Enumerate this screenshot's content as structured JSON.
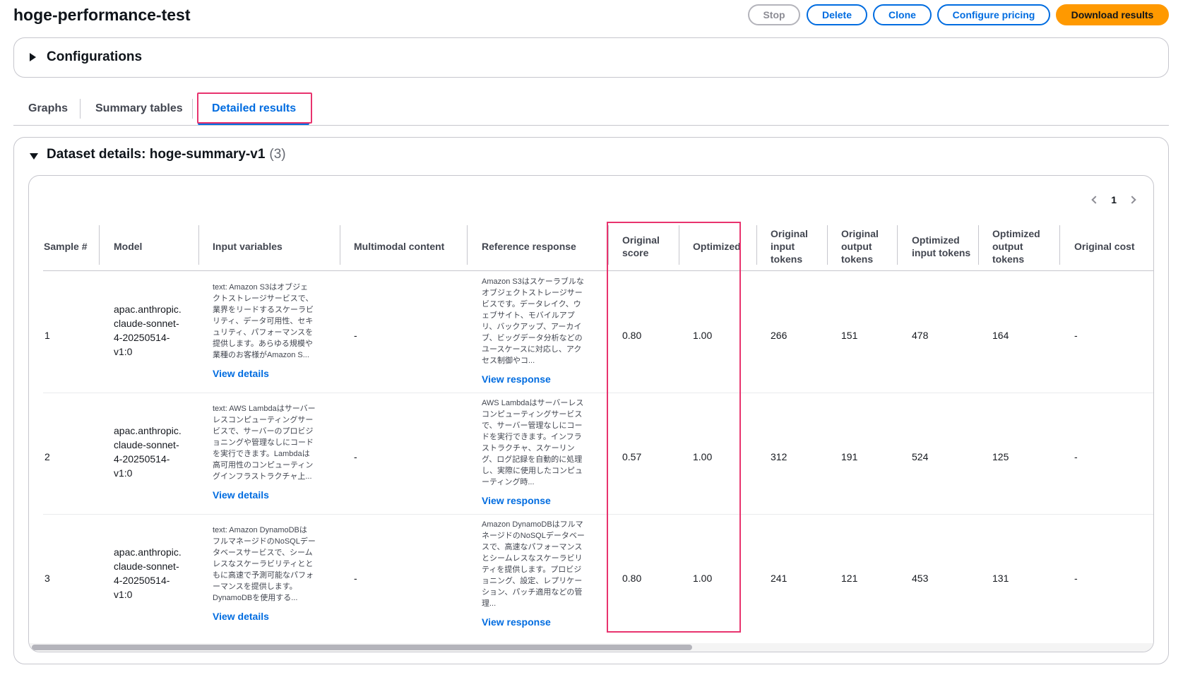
{
  "page": {
    "title": "hoge-performance-test"
  },
  "actions": {
    "stop": "Stop",
    "delete": "Delete",
    "clone": "Clone",
    "configure_pricing": "Configure pricing",
    "download_results": "Download results"
  },
  "configurations": {
    "title": "Configurations"
  },
  "tabs": [
    {
      "label": "Graphs"
    },
    {
      "label": "Summary tables"
    },
    {
      "label": "Detailed results"
    }
  ],
  "dataset": {
    "title": "Dataset details: hoge-summary-v1",
    "count": "(3)"
  },
  "pagination": {
    "current_page": "1"
  },
  "table": {
    "columns": [
      "Sample #",
      "Model",
      "Input variables",
      "Multimodal content",
      "Reference response",
      "Original score",
      "Optimized score",
      "Original input tokens",
      "Original output tokens",
      "Optimized input tokens",
      "Optimized output tokens",
      "Original cost"
    ],
    "view_details_label": "View details",
    "view_response_label": "View response",
    "rows": [
      {
        "sample": "1",
        "model": [
          "apac.anthropic.",
          "claude-sonnet-",
          "4-20250514-",
          "v1:0"
        ],
        "input_variables": [
          "text: Amazon S3はオブジェ",
          "クトストレージサービスで、",
          "業界をリードするスケーラビ",
          "リティ、データ可用性、セキ",
          "ュリティ、パフォーマンスを",
          "提供します。あらゆる規模や",
          "業種のお客様がAmazon S..."
        ],
        "multimodal": "-",
        "reference_response": [
          "Amazon S3はスケーラブルな",
          "オブジェクトストレージサー",
          "ビスです。データレイク、ウ",
          "ェブサイト、モバイルアプ",
          "リ、バックアップ、アーカイ",
          "ブ、ビッグデータ分析などの",
          "ユースケースに対応し、アク",
          "セス制御やコ..."
        ],
        "original_score": "0.80",
        "optimized_score": "1.00",
        "original_input_tokens": "266",
        "original_output_tokens": "151",
        "optimized_input_tokens": "478",
        "optimized_output_tokens": "164",
        "original_cost": "-"
      },
      {
        "sample": "2",
        "model": [
          "apac.anthropic.",
          "claude-sonnet-",
          "4-20250514-",
          "v1:0"
        ],
        "input_variables": [
          "text: AWS Lambdaはサーバー",
          "レスコンピューティングサー",
          "ビスで、サーバーのプロビジ",
          "ョニングや管理なしにコード",
          "を実行できます。Lambdaは",
          "高可用性のコンピューティン",
          "グインフラストラクチャ上..."
        ],
        "multimodal": "-",
        "reference_response": [
          "AWS Lambdaはサーバーレス",
          "コンピューティングサービス",
          "で、サーバー管理なしにコー",
          "ドを実行できます。インフラ",
          "ストラクチャ、スケーリン",
          "グ、ログ記録を自動的に処理",
          "し、実際に使用したコンピュ",
          "ーティング時..."
        ],
        "original_score": "0.57",
        "optimized_score": "1.00",
        "original_input_tokens": "312",
        "original_output_tokens": "191",
        "optimized_input_tokens": "524",
        "optimized_output_tokens": "125",
        "original_cost": "-"
      },
      {
        "sample": "3",
        "model": [
          "apac.anthropic.",
          "claude-sonnet-",
          "4-20250514-",
          "v1:0"
        ],
        "input_variables": [
          "text: Amazon DynamoDBは",
          "フルマネージドのNoSQLデー",
          "タベースサービスで、シーム",
          "レスなスケーラビリティとと",
          "もに高速で予測可能なパフォ",
          "ーマンスを提供します。",
          "DynamoDBを使用する..."
        ],
        "multimodal": "-",
        "reference_response": [
          "Amazon DynamoDBはフルマ",
          "ネージドのNoSQLデータベー",
          "スで、高速なパフォーマンス",
          "とシームレスなスケーラビリ",
          "ティを提供します。プロビジ",
          "ョニング、設定、レプリケー",
          "ション、パッチ適用などの管",
          "理..."
        ],
        "original_score": "0.80",
        "optimized_score": "1.00",
        "original_input_tokens": "241",
        "original_output_tokens": "121",
        "optimized_input_tokens": "453",
        "optimized_output_tokens": "131",
        "original_cost": "-"
      }
    ]
  }
}
